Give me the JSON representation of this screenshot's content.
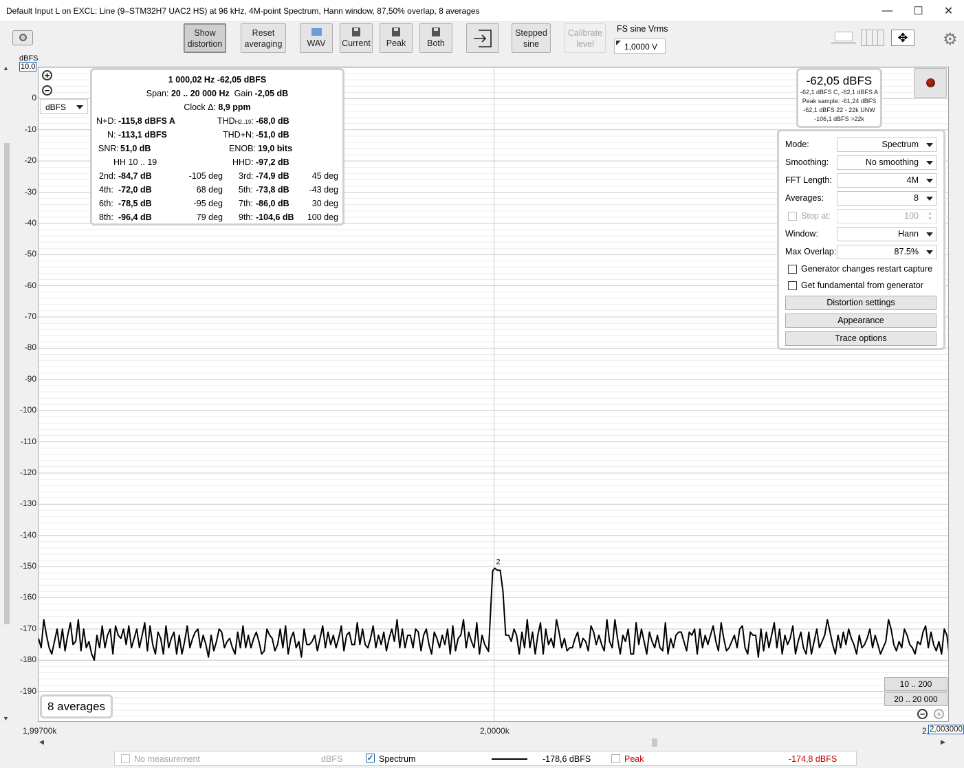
{
  "window": {
    "title": "Default Input L on EXCL: Line (9–STM32H7 UAC2 HS) at 96 kHz, 4M-point Spectrum, Hann window, 87,50% overlap, 8 averages",
    "minimize": "—",
    "maximize": "☐",
    "close": "✕"
  },
  "toolbar": {
    "show_distortion": [
      "Show",
      "distortion"
    ],
    "reset_averaging": [
      "Reset",
      "averaging"
    ],
    "wav": "WAV",
    "current": "Current",
    "peak": "Peak",
    "both": "Both",
    "stepped_sine": [
      "Stepped",
      "sine"
    ],
    "calibrate_level": [
      "Calibrate",
      "level"
    ],
    "fs_label": "FS sine Vrms",
    "fs_value": "1,0000 V"
  },
  "plot": {
    "y_unit": "dBFS",
    "y_top_value": "10,0",
    "unit_select": "dBFS",
    "y_ticks": [
      "0",
      "-10",
      "-20",
      "-30",
      "-40",
      "-50",
      "-60",
      "-70",
      "-80",
      "-90",
      "-100",
      "-110",
      "-120",
      "-130",
      "-140",
      "-150",
      "-160",
      "-170",
      "-180",
      "-190"
    ],
    "x_left": "1,99700k",
    "x_center": "2,0000k",
    "x_right_prefix": "2,",
    "x_right_value": "2,003000",
    "peak_label": "2",
    "averages_badge": "8 averages",
    "range_btn_1": "10 .. 200",
    "range_btn_2": "20 .. 20 000"
  },
  "info": {
    "fundamental": "1 000,02 Hz  -62,05 dBFS",
    "span_label": "Span:",
    "span_value": "20 .. 20 000 Hz",
    "gain_label": "Gain",
    "gain_value": "-2,05 dB",
    "clock_label": "Clock Δ:",
    "clock_value": "8,9 ppm",
    "nd_label": "N+D:",
    "nd_value": "-115,8 dBFS A",
    "thd_label": "THD",
    "thd_sub": "H2..19",
    "thd_value": "-68,0 dB",
    "n_label": "N:",
    "n_value": "-113,1 dBFS",
    "thdn_label": "THD+N:",
    "thdn_value": "-51,0 dB",
    "snr_label": "SNR:",
    "snr_value": "51,0 dB",
    "enob_label": "ENOB:",
    "enob_value": "19,0 bits",
    "hh_label": "HH 10 .. 19",
    "hhd_label": "HHD:",
    "hhd_value": "-97,2 dB",
    "harmonics": [
      {
        "label": "2nd:",
        "value": "-84,7 dB",
        "phase": "-105 deg"
      },
      {
        "label": "3rd:",
        "value": "-74,9 dB",
        "phase": "45 deg"
      },
      {
        "label": "4th:",
        "value": "-72,0 dB",
        "phase": "68 deg"
      },
      {
        "label": "5th:",
        "value": "-73,8 dB",
        "phase": "-43 deg"
      },
      {
        "label": "6th:",
        "value": "-78,5 dB",
        "phase": "-95 deg"
      },
      {
        "label": "7th:",
        "value": "-86,0 dB",
        "phase": "30 deg"
      },
      {
        "label": "8th:",
        "value": "-96,4 dB",
        "phase": "79 deg"
      },
      {
        "label": "9th:",
        "value": "-104,6 dB",
        "phase": "100 deg"
      }
    ]
  },
  "readout": {
    "main": "-62,05 dBFS",
    "line1": "-62,1 dBFS C, -62,1 dBFS A",
    "line2": "Peak sample: -61,24 dBFS",
    "line3": "-62,1 dBFS 22 - 22k UNW",
    "line4": "-106,1 dBFS >22k"
  },
  "settings": {
    "mode_label": "Mode:",
    "mode_value": "Spectrum",
    "smoothing_label": "Smoothing:",
    "smoothing_value": "No smoothing",
    "fft_label": "FFT Length:",
    "fft_value": "4M",
    "averages_label": "Averages:",
    "averages_value": "8",
    "stop_label": "Stop at:",
    "stop_value": "100",
    "window_label": "Window:",
    "window_value": "Hann",
    "overlap_label": "Max Overlap:",
    "overlap_value": "87.5%",
    "gen_restart": "Generator changes restart capture",
    "gen_fundamental": "Get fundamental from generator",
    "distortion_settings": "Distortion settings",
    "appearance": "Appearance",
    "trace_options": "Trace options"
  },
  "statusbar": {
    "no_measurement": "No measurement",
    "no_measurement_unit": "dBFS",
    "spectrum": "Spectrum",
    "spectrum_value": "-178,6 dBFS",
    "peak": "Peak",
    "peak_value": "-174,8 dBFS",
    "peak_color": "#c00000"
  },
  "trace": {
    "x_min_hz": 1997,
    "x_max_hz": 2003,
    "y_min_db": -200,
    "y_max_db": 10,
    "peak_hz": 2000,
    "peak_db": -150.5,
    "points_db": [
      -173,
      -176,
      -167,
      -172,
      -176,
      -178,
      -174,
      -170,
      -176,
      -170,
      -177,
      -172,
      -168,
      -175,
      -174,
      -167,
      -177,
      -170,
      -176,
      -174,
      -178,
      -180,
      -172,
      -176,
      -169,
      -176,
      -172,
      -170,
      -178,
      -169,
      -172,
      -173,
      -170,
      -175,
      -169,
      -176,
      -173,
      -170,
      -176,
      -172,
      -168,
      -177,
      -169,
      -175,
      -178,
      -171,
      -173,
      -178,
      -169,
      -176,
      -173,
      -171,
      -178,
      -172,
      -178,
      -174,
      -169,
      -176,
      -173,
      -171,
      -170,
      -176,
      -172,
      -175,
      -179,
      -172,
      -177,
      -174,
      -170,
      -171,
      -176,
      -174,
      -173,
      -176,
      -178,
      -171,
      -176,
      -169,
      -176,
      -172,
      -176,
      -173,
      -171,
      -174,
      -178,
      -177,
      -170,
      -172,
      -173,
      -177,
      -175,
      -170,
      -176,
      -169,
      -178,
      -173,
      -171,
      -176,
      -174,
      -179,
      -170,
      -175,
      -175,
      -174,
      -172,
      -177,
      -173,
      -169,
      -176,
      -171,
      -175,
      -172,
      -176,
      -173,
      -169,
      -177,
      -172,
      -171,
      -175,
      -175,
      -168,
      -175,
      -170,
      -175,
      -176,
      -173,
      -169,
      -176,
      -172,
      -175,
      -171,
      -177,
      -173,
      -170,
      -174,
      -167,
      -176,
      -170,
      -176,
      -172,
      -172,
      -176,
      -170,
      -171,
      -177,
      -172,
      -170,
      -175,
      -178,
      -171,
      -173,
      -176,
      -172,
      -175,
      -170,
      -178,
      -169,
      -177,
      -173,
      -172,
      -167,
      -176,
      -171,
      -174,
      -176,
      -168,
      -178,
      -172,
      -175,
      -170,
      -170,
      -176,
      -173,
      -168,
      -177,
      -170,
      -177,
      -172,
      -174,
      -170,
      -172,
      -178,
      -171,
      -176,
      -167,
      -176,
      -171,
      -178,
      -172,
      -168,
      -178,
      -170,
      -175,
      -173,
      -176,
      -167,
      -171,
      -176,
      -173,
      -177,
      -176,
      -176,
      -173,
      -171,
      -176,
      -173,
      -174,
      -177,
      -169,
      -171,
      -175,
      -172,
      -175,
      -177,
      -167,
      -174,
      -176,
      -167,
      -173,
      -178,
      -172,
      -174,
      -170,
      -178,
      -178,
      -168,
      -175,
      -170,
      -174,
      -178,
      -171,
      -174,
      -176,
      -172,
      -176,
      -177,
      -168,
      -178,
      -173,
      -176,
      -172,
      -171,
      -171,
      -174,
      -177,
      -171,
      -172,
      -170,
      -178,
      -170,
      -176,
      -172,
      -175,
      -172,
      -169,
      -174,
      -177,
      -168,
      -173,
      -177,
      -176,
      -174,
      -172,
      -176,
      -170,
      -169,
      -176,
      -178,
      -171,
      -172,
      -172,
      -179,
      -170,
      -177,
      -171,
      -176,
      -172,
      -168,
      -176,
      -170,
      -178,
      -172,
      -175,
      -173,
      -169,
      -178,
      -174,
      -171,
      -176,
      -178,
      -171,
      -178,
      -174,
      -170,
      -176,
      -174,
      -172,
      -167,
      -171,
      -175,
      -178,
      -172,
      -176,
      -171,
      -175,
      -170,
      -173,
      -175,
      -178,
      -172,
      -176,
      -175,
      -173,
      -170,
      -176,
      -172,
      -175,
      -178,
      -176,
      -174,
      -167,
      -170,
      -175,
      -177,
      -174,
      -176,
      -170,
      -172,
      -175,
      -176,
      -178,
      -174,
      -175,
      -171,
      -169,
      -176,
      -171,
      -175,
      -177,
      -174,
      -178,
      -170,
      -172,
      -179
    ]
  }
}
